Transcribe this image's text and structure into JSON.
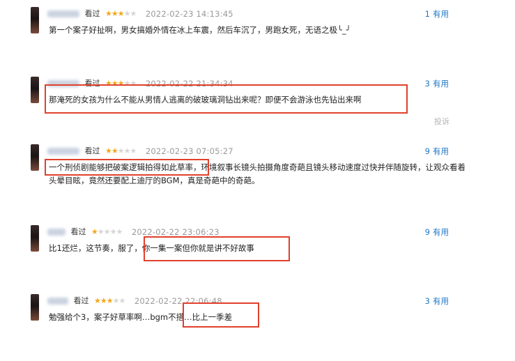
{
  "comments": [
    {
      "seen_label": "看过",
      "stars": 3,
      "time": "2022-02-23 14:13:45",
      "useful_count": "1",
      "useful_label": "有用",
      "text": "第一个案子好扯啊，男女搞婚外情在冰上车震，然后车沉了，男跑女死，无语之极╰_╯"
    },
    {
      "seen_label": "看过",
      "stars": 3,
      "time": "2022-02-22 21:34:34",
      "useful_count": "3",
      "useful_label": "有用",
      "text": "那淹死的女孩为什么不能从男情人逃离的破玻璃洞钻出来呢？即便不会游泳也先钻出来啊",
      "report_label": "投诉"
    },
    {
      "seen_label": "看过",
      "stars": 2,
      "time": "2022-02-23 07:05:27",
      "useful_count": "9",
      "useful_label": "有用",
      "text": "一个刑侦剧能够把破案逻辑拍得如此草率，环境叙事长镜头拍摄角度奇葩且镜头移动速度过快并伴随旋转，让观众看着头晕目眩，竟然还要配上迪厅的BGM，真是奇葩中的奇葩。"
    },
    {
      "seen_label": "看过",
      "stars": 1,
      "time": "2022-02-22 23:06:23",
      "useful_count": "9",
      "useful_label": "有用",
      "text": "比1还烂，这节奏，服了，你一集一案但你就是讲不好故事"
    },
    {
      "seen_label": "看过",
      "stars": 3,
      "time": "2022-02-22 22:06:48",
      "useful_count": "3",
      "useful_label": "有用",
      "text": "勉强给个3，案子好草率啊…bgm不搭…比上一季差"
    }
  ],
  "colors": {
    "highlight": "#e0402b",
    "link": "#1f78c6",
    "star": "#f2a81c"
  }
}
